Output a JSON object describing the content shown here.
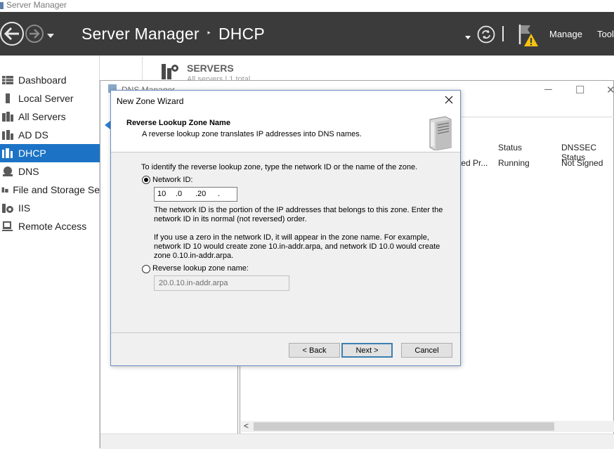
{
  "server_manager": {
    "window_title": "Server Manager",
    "breadcrumb": {
      "app": "Server Manager",
      "separator": "‣",
      "page": "DHCP"
    },
    "header": {
      "manage_label": "Manage",
      "tools_label": "Tools",
      "refresh_icon": "refresh-icon",
      "flag_icon": "flag-warning-icon"
    },
    "sidebar": {
      "items": [
        {
          "label": "Dashboard",
          "icon": "dashboard-icon",
          "active": false
        },
        {
          "label": "Local Server",
          "icon": "local-server-icon",
          "active": false
        },
        {
          "label": "All Servers",
          "icon": "all-servers-icon",
          "active": false
        },
        {
          "label": "AD DS",
          "icon": "adds-icon",
          "active": false
        },
        {
          "label": "DHCP",
          "icon": "dhcp-icon",
          "active": true
        },
        {
          "label": "DNS",
          "icon": "dns-icon",
          "active": false
        },
        {
          "label": "File and Storage Se",
          "icon": "file-storage-icon",
          "active": false
        },
        {
          "label": "IIS",
          "icon": "iis-icon",
          "active": false
        },
        {
          "label": "Remote Access",
          "icon": "remote-access-icon",
          "active": false
        }
      ]
    },
    "servers_tile": {
      "label": "SERVERS",
      "sub": "All servers | 1 total"
    }
  },
  "dns_manager": {
    "title": "DNS Manager",
    "columns": [
      "Status",
      "DNSSEC Status"
    ],
    "row": {
      "truncated": "ted Pr...",
      "status": "Running",
      "dnssec": "Not Signed"
    }
  },
  "wizard": {
    "title": "New Zone Wizard",
    "heading": "Reverse Lookup Zone Name",
    "subheading": "A reverse lookup zone translates IP addresses into DNS names.",
    "intro": "To identify the reverse lookup zone, type the network ID or the name of the zone.",
    "network_id_label": "Network ID:",
    "network_id_octets": [
      "10",
      ".0",
      ".20",
      "."
    ],
    "network_id_help": "The network ID is the portion of the IP addresses that belongs to this zone. Enter the network ID in its normal (not reversed) order.",
    "zero_note": "If you use a zero in the network ID, it will appear in the zone name. For example, network ID 10 would create zone 10.in-addr.arpa, and network ID 10.0 would create zone 0.10.in-addr.arpa.",
    "zone_name_label": "Reverse lookup zone name:",
    "zone_name_value": "20.0.10.in-addr.arpa",
    "selected_option": "network_id",
    "buttons": {
      "back": "< Back",
      "next": "Next >",
      "cancel": "Cancel"
    }
  },
  "colors": {
    "header_bg": "#3b3b3b",
    "active_nav": "#1c73c6",
    "warning": "#f5c211"
  }
}
